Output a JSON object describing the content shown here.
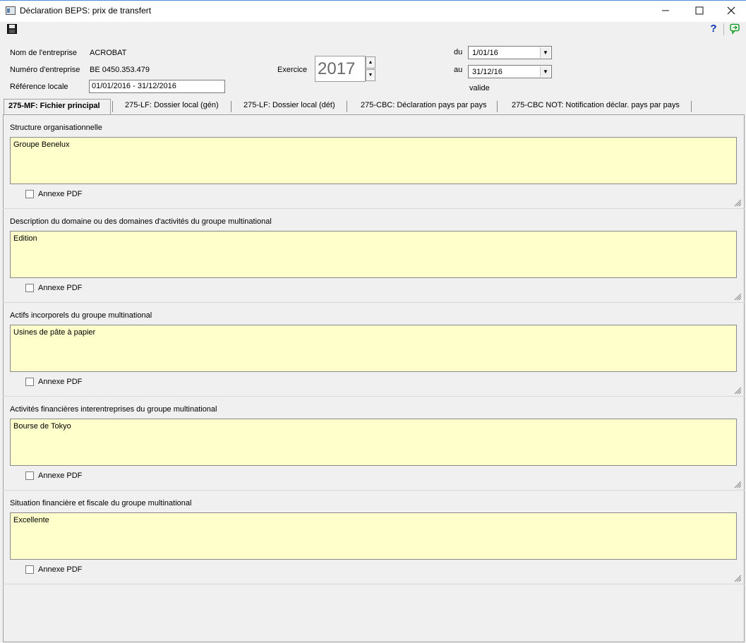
{
  "window": {
    "title": "Déclaration BEPS: prix de transfert"
  },
  "header": {
    "company_name_label": "Nom de l'entreprise",
    "company_name_value": "ACROBAT",
    "company_number_label": "Numéro d'entreprise",
    "company_number_value": "BE 0450.353.479",
    "local_ref_label": "Référence locale",
    "local_ref_value": "01/01/2016 - 31/12/2016",
    "exercise_label": "Exercice",
    "exercise_value": "2017",
    "from_label": "du",
    "from_value": "1/01/16",
    "to_label": "au",
    "to_value": "31/12/16",
    "status": "valide"
  },
  "tabs": [
    {
      "label": "275-MF: Fichier principal"
    },
    {
      "label": "275-LF: Dossier local (gén)"
    },
    {
      "label": "275-LF: Dossier local (dét)"
    },
    {
      "label": "275-CBC: Déclaration pays par pays"
    },
    {
      "label": "275-CBC NOT: Notification déclar. pays par pays"
    }
  ],
  "sections": [
    {
      "title": "Structure organisationnelle",
      "value": "Groupe Benelux",
      "checkbox_label": "Annexe PDF"
    },
    {
      "title": "Description du domaine ou des domaines d'activités du groupe multinational",
      "value": "Edition",
      "checkbox_label": "Annexe PDF"
    },
    {
      "title": "Actifs incorporels du groupe multinational",
      "value": "Usines de pâte à papier",
      "checkbox_label": "Annexe PDF"
    },
    {
      "title": "Activités financières interentreprises du groupe multinational",
      "value": "Bourse de Tokyo",
      "checkbox_label": "Annexe PDF"
    },
    {
      "title": "Situation financière et fiscale du groupe multinational",
      "value": "Excellente",
      "checkbox_label": "Annexe PDF"
    }
  ],
  "icons": {
    "save": "floppy-disk-icon",
    "help": "question-mark-icon",
    "exit": "exit-icon",
    "help_color": "#0a2fb0",
    "exit_color": "#1a9a2a",
    "textarea_color": "#ffffcc"
  }
}
